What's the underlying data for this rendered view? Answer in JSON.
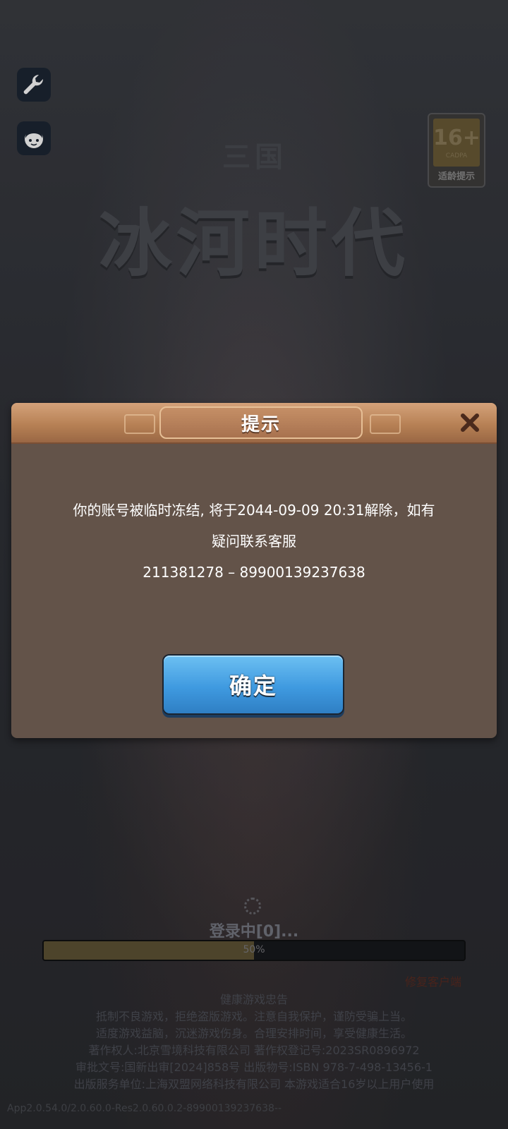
{
  "age_rating": {
    "number": "16+",
    "sub": "CADPA",
    "label": "适龄提示"
  },
  "logo": {
    "small": "三国",
    "big": "冰河时代"
  },
  "dialog": {
    "title": "提示",
    "message_line1": "你的账号被临时冻结, 将于2044-09-09 20:31解除，如有",
    "message_line2": "疑问联系客服",
    "message_line3": "211381278 – 89900139237638",
    "confirm_label": "确定"
  },
  "loading": {
    "status": "登录中[0]...",
    "progress_text": "50%",
    "progress_value": 0.5,
    "fix_link": "修复客户端"
  },
  "notice": {
    "title": "健康游戏忠告",
    "line1": "抵制不良游戏，拒绝盗版游戏。注意自我保护，谨防受骗上当。",
    "line2": "适度游戏益脑，沉迷游戏伤身。合理安排时间，享受健康生活。",
    "line3": "著作权人:北京雪境科技有限公司  著作权登记号:2023SR0896972",
    "line4": "审批文号:国新出审[2024]858号  出版物号:ISBN 978-7-498-13456-1",
    "line5": "出版服务单位:上海双盟网络科技有限公司  本游戏适合16岁以上用户使用"
  },
  "version": "App2.0.54.0/2.0.60.0-Res2.0.60.0.2-89900139237638--",
  "colors": {
    "dialog_bg": "#635349",
    "header": "#b78155",
    "confirm": "#3f9ae0"
  },
  "icons": {
    "settings": "wrench-icon",
    "service": "customer-service-icon",
    "close": "close-icon"
  }
}
